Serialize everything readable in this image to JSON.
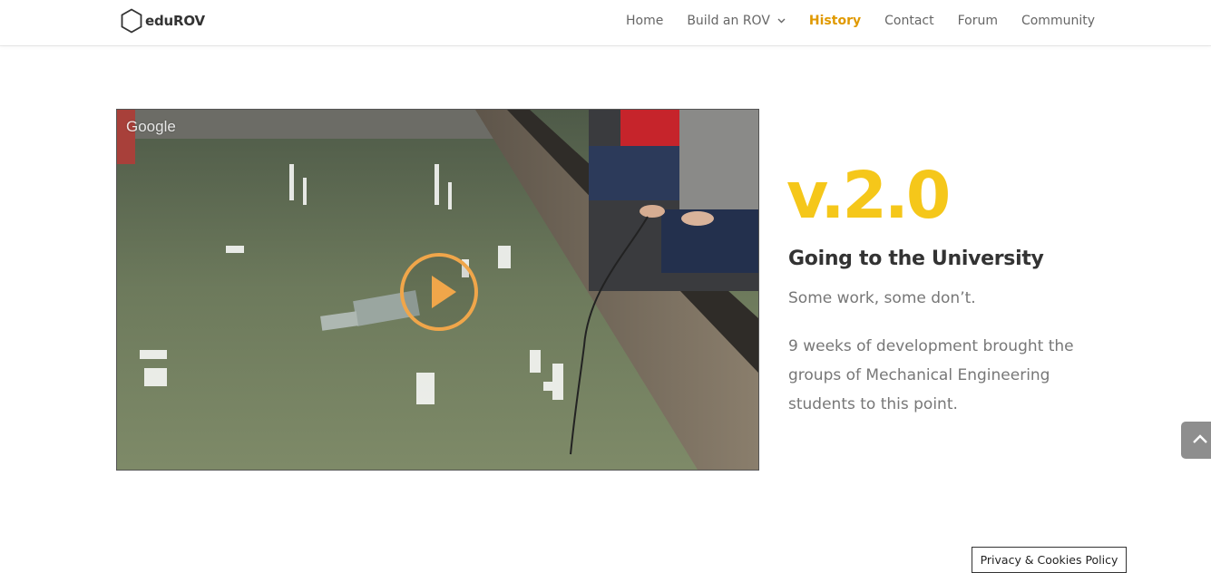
{
  "header": {
    "logo_text": "eduROV",
    "nav": [
      {
        "label": "Home"
      },
      {
        "label": "Build an ROV"
      },
      {
        "label": "History"
      },
      {
        "label": "Contact"
      },
      {
        "label": "Forum"
      },
      {
        "label": "Community"
      }
    ]
  },
  "video": {
    "watermark": "Google",
    "play_color": "#f0a64a"
  },
  "content": {
    "version": "v.2.0",
    "subtitle": "Going to the University",
    "line1": "Some work, some don’t.",
    "paragraph": "9 weeks of development brought the groups of Mechanical Engineering students to this point."
  },
  "footer": {
    "privacy_label": "Privacy & Cookies Policy"
  },
  "colors": {
    "accent_yellow": "#f5c71a",
    "active_nav": "#e09900"
  }
}
